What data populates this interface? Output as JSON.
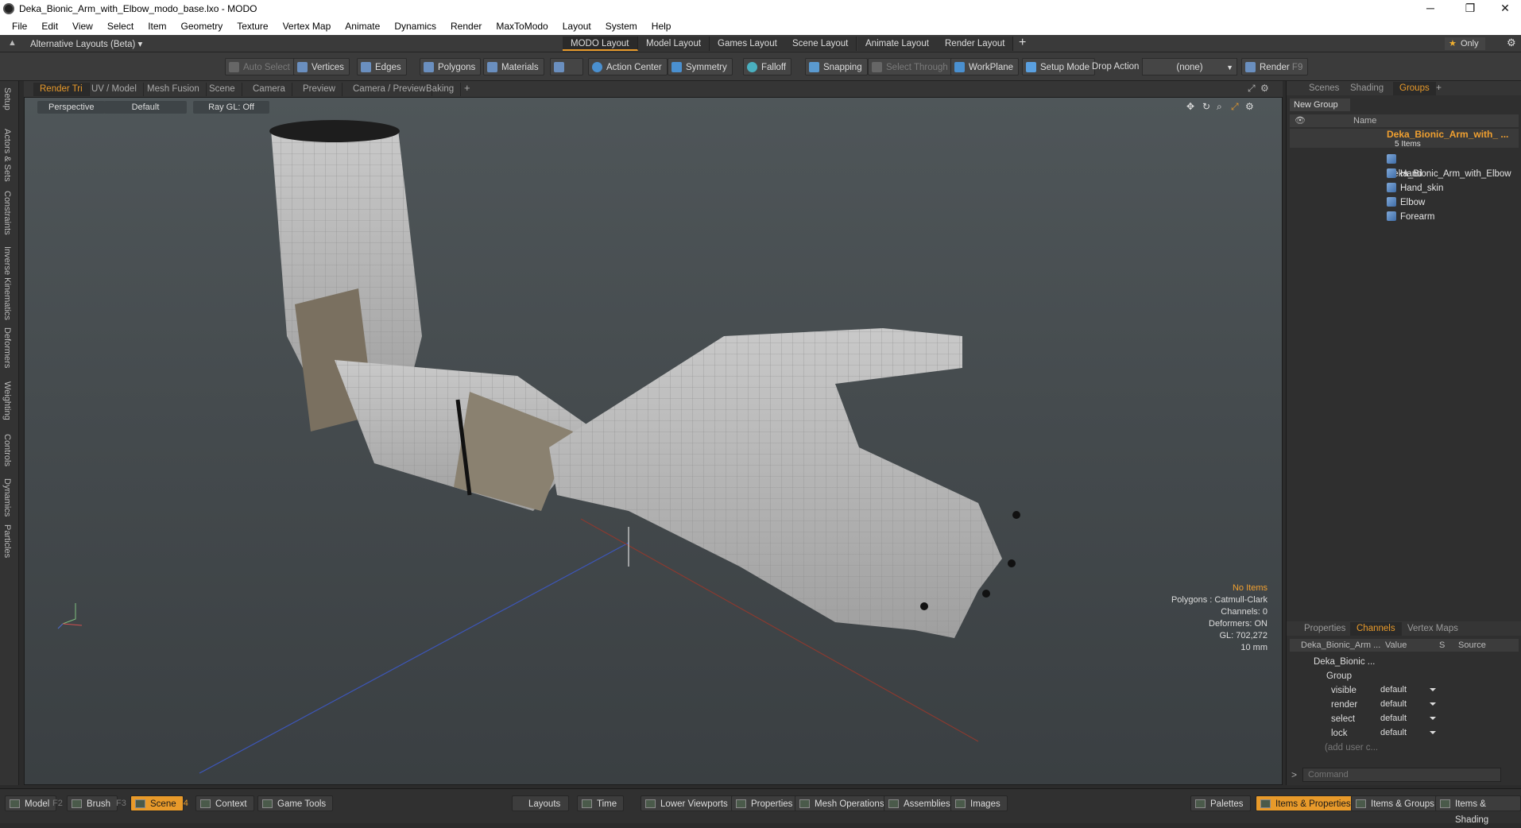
{
  "window": {
    "title": "Deka_Bionic_Arm_with_Elbow_modo_base.lxo - MODO",
    "minimize": "─",
    "restore": "❐",
    "close": "✕"
  },
  "menu": [
    "File",
    "Edit",
    "View",
    "Select",
    "Item",
    "Geometry",
    "Texture",
    "Vertex Map",
    "Animate",
    "Dynamics",
    "Render",
    "MaxToModo",
    "Layout",
    "System",
    "Help"
  ],
  "layouts": {
    "selector": "Alternative Layouts (Beta)",
    "tabs": [
      "MODO Layout",
      "Model Layout",
      "Games Layout",
      "Scene Layout",
      "Animate Layout",
      "Render Layout"
    ],
    "add": "+",
    "only": "Only"
  },
  "toolbar": {
    "auto_select": "Auto Select",
    "vertices": "Vertices",
    "edges": "Edges",
    "polygons": "Polygons",
    "materials": "Materials",
    "action_center": "Action Center",
    "symmetry": "Symmetry",
    "falloff": "Falloff",
    "snapping": "Snapping",
    "select_through": "Select Through",
    "workplane": "WorkPlane",
    "setup_mode": "Setup Mode",
    "drop_action": "Drop Action",
    "drop_value": "(none)",
    "render": "Render",
    "render_key": "F9"
  },
  "left_tabs": [
    "Setup",
    "Actors & Sets",
    "Constraints",
    "Inverse Kinematics",
    "Deformers",
    "Weighting",
    "Controls",
    "Dynamics",
    "Particles"
  ],
  "viewport_tabs": [
    "Render Tri",
    "UV / Model",
    "Mesh Fusion",
    "Scene",
    "Camera",
    "Preview",
    "Camera / Preview",
    "Baking"
  ],
  "viewport": {
    "view": "Perspective",
    "shading": "Default",
    "raygl": "Ray GL: Off",
    "info": {
      "selection": "No Items",
      "polygons": "Polygons : Catmull-Clark",
      "channels": "Channels: 0",
      "deformers": "Deformers: ON",
      "gl": "GL: 702,272",
      "scale": "10 mm"
    }
  },
  "groups_panel": {
    "tabs": [
      "Scenes",
      "Shading",
      "Groups"
    ],
    "new_group": "New Group",
    "name_col": "Name",
    "root": "Deka_Bionic_Arm_with_ ...",
    "root_count": "5 Items",
    "items": [
      "Deka_Bionic_Arm_with_Elbow",
      "Hand",
      "Hand_skin",
      "Elbow",
      "Forearm"
    ]
  },
  "channels_panel": {
    "tabs": [
      "Properties",
      "Channels",
      "Vertex Maps"
    ],
    "cols": {
      "name": "Deka_Bionic_Arm ...",
      "value": "Value",
      "s": "S",
      "source": "Source"
    },
    "root": "Deka_Bionic ...",
    "group": "Group",
    "rows": [
      {
        "name": "visible",
        "value": "default"
      },
      {
        "name": "render",
        "value": "default"
      },
      {
        "name": "select",
        "value": "default"
      },
      {
        "name": "lock",
        "value": "default"
      }
    ],
    "add_user": "(add user c...",
    "command_placeholder": "Command"
  },
  "statusbar": {
    "model": "Model",
    "model_key": "F2",
    "brush": "Brush",
    "brush_key": "F3",
    "scene": "Scene",
    "scene_key": "F4",
    "context": "Context",
    "game_tools": "Game Tools",
    "layouts": "Layouts",
    "time": "Time",
    "lower_viewports": "Lower Viewports",
    "properties": "Properties",
    "mesh_operations": "Mesh Operations",
    "assemblies": "Assemblies",
    "images": "Images",
    "palettes": "Palettes",
    "items_properties": "Items & Properties",
    "items_groups": "Items & Groups",
    "items_shading": "Items & Shading"
  },
  "colors": {
    "accent": "#e89a2a",
    "panel": "#2f2f2f",
    "viewport_top": "#4f5659"
  }
}
